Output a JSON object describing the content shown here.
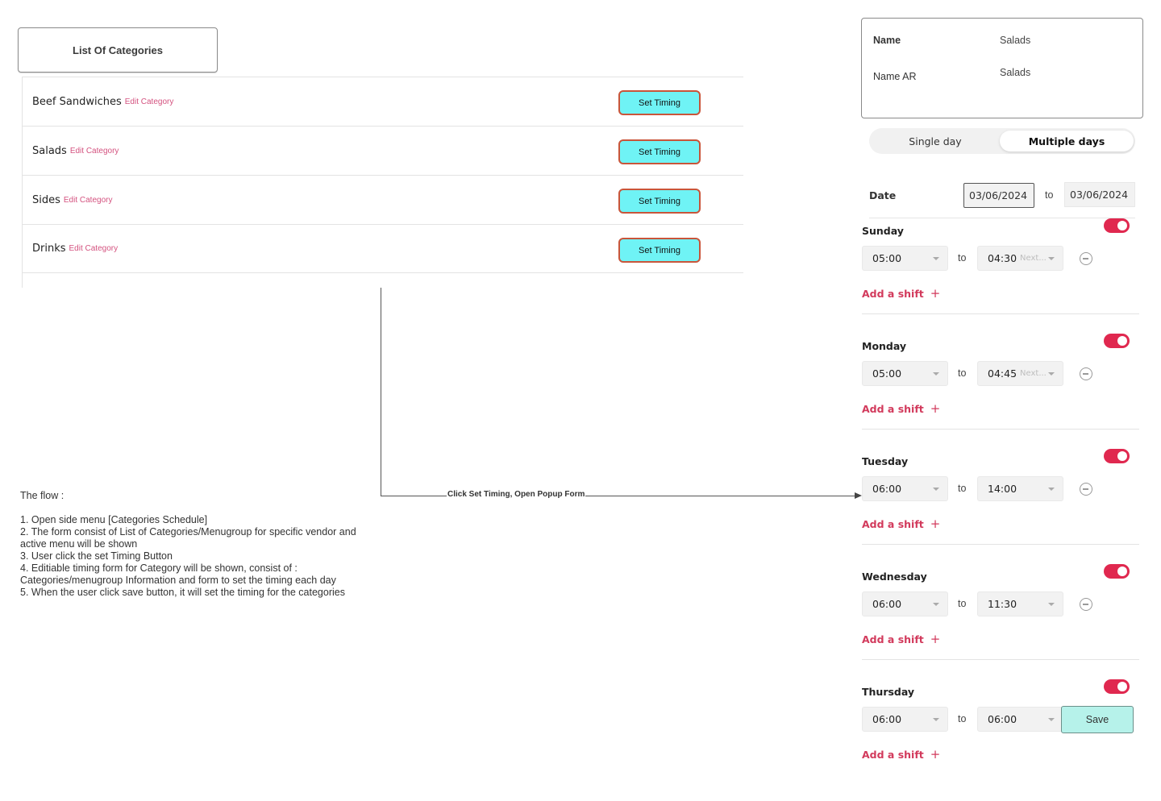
{
  "categories_panel": {
    "title": "List Of Categories",
    "edit_label": "Edit Category",
    "set_timing_label": "Set Timing",
    "items": [
      {
        "name": "Beef Sandwiches"
      },
      {
        "name": "Salads"
      },
      {
        "name": "Sides"
      },
      {
        "name": "Drinks"
      }
    ]
  },
  "flow_notes": {
    "text": "The flow :\n\n1. Open side menu [Categories Schedule]\n2. The form consist of List of Categories/Menugroup for specific vendor and active menu will be shown\n3. User click the set Timing Button\n4. Editiable timing form for Category will be shown, consist of : Categories/menugroup Information and form to set the timing each day\n5. When the user click save button, it will set the timing for the categories"
  },
  "connector": {
    "label": "Click Set Timing, Open Popup  Form"
  },
  "timing_form": {
    "info": {
      "name_label": "Name",
      "name_value": "Salads",
      "name_ar_label": "Name AR",
      "name_ar_value": "Salads"
    },
    "mode_toggle": {
      "single": "Single day",
      "multiple": "Multiple days",
      "selected": "Multiple days"
    },
    "date": {
      "label": "Date",
      "from": "03/06/2024",
      "to_label": "to",
      "to": "03/06/2024"
    },
    "to_label": "to",
    "add_shift_label": "Add a shift",
    "add_shift_icon": "+",
    "next_hint": "Next...",
    "save_label": "Save",
    "accent_color": "#e0284f",
    "days": [
      {
        "name": "Sunday",
        "enabled": true,
        "from": "05:00",
        "to": "04:30",
        "to_next_day": true
      },
      {
        "name": "Monday",
        "enabled": true,
        "from": "05:00",
        "to": "04:45",
        "to_next_day": true
      },
      {
        "name": "Tuesday",
        "enabled": true,
        "from": "06:00",
        "to": "14:00",
        "to_next_day": false
      },
      {
        "name": "Wednesday",
        "enabled": true,
        "from": "06:00",
        "to": "11:30",
        "to_next_day": false
      },
      {
        "name": "Thursday",
        "enabled": true,
        "from": "06:00",
        "to": "06:00",
        "to_next_day": false
      }
    ]
  }
}
